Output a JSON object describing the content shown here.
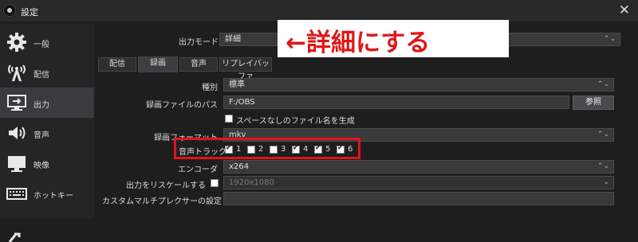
{
  "window": {
    "title": "設定",
    "close_symbol": "✕"
  },
  "sidebar": {
    "items": [
      {
        "label": "一般",
        "icon": "gear-icon"
      },
      {
        "label": "配信",
        "icon": "broadcast-antenna-icon"
      },
      {
        "label": "出力",
        "icon": "monitor-output-icon"
      },
      {
        "label": "音声",
        "icon": "speaker-icon"
      },
      {
        "label": "映像",
        "icon": "display-icon"
      },
      {
        "label": "ホットキー",
        "icon": "keyboard-icon"
      }
    ],
    "active_index": 2
  },
  "output_mode": {
    "label": "出力モード",
    "value": "詳細"
  },
  "tabs": [
    {
      "label": "配信"
    },
    {
      "label": "録画"
    },
    {
      "label": "音声"
    },
    {
      "label": "リプレイバッファ"
    }
  ],
  "active_tab_index": 1,
  "form": {
    "type": {
      "label": "種別",
      "value": "標準"
    },
    "path": {
      "label": "録画ファイルのパス",
      "value": "F:/OBS",
      "browse": "参照"
    },
    "no_space": {
      "label": "スペースなしのファイル名を生成",
      "checked": false
    },
    "format": {
      "label": "録画フォーマット",
      "value": "mkv"
    },
    "audio_track": {
      "label": "音声トラック",
      "tracks": [
        {
          "label": "1",
          "checked": true
        },
        {
          "label": "2",
          "checked": false
        },
        {
          "label": "3",
          "checked": false
        },
        {
          "label": "4",
          "checked": true
        },
        {
          "label": "5",
          "checked": true
        },
        {
          "label": "6",
          "checked": true
        }
      ]
    },
    "encoder": {
      "label": "エンコーダ",
      "value": "x264"
    },
    "rescale": {
      "label": "出力をリスケールする",
      "value": "1920x1080",
      "checked": false
    },
    "muxer": {
      "label": "カスタムマルチプレクサーの設定",
      "value": ""
    }
  },
  "annotation": {
    "text": "←詳細にする",
    "color": "#e01616",
    "box_color": "#e0141a"
  },
  "colors": {
    "background": "#1f1e1f",
    "sidebar_active": "#3a3b3f",
    "highlight_red": "#e0141a"
  }
}
